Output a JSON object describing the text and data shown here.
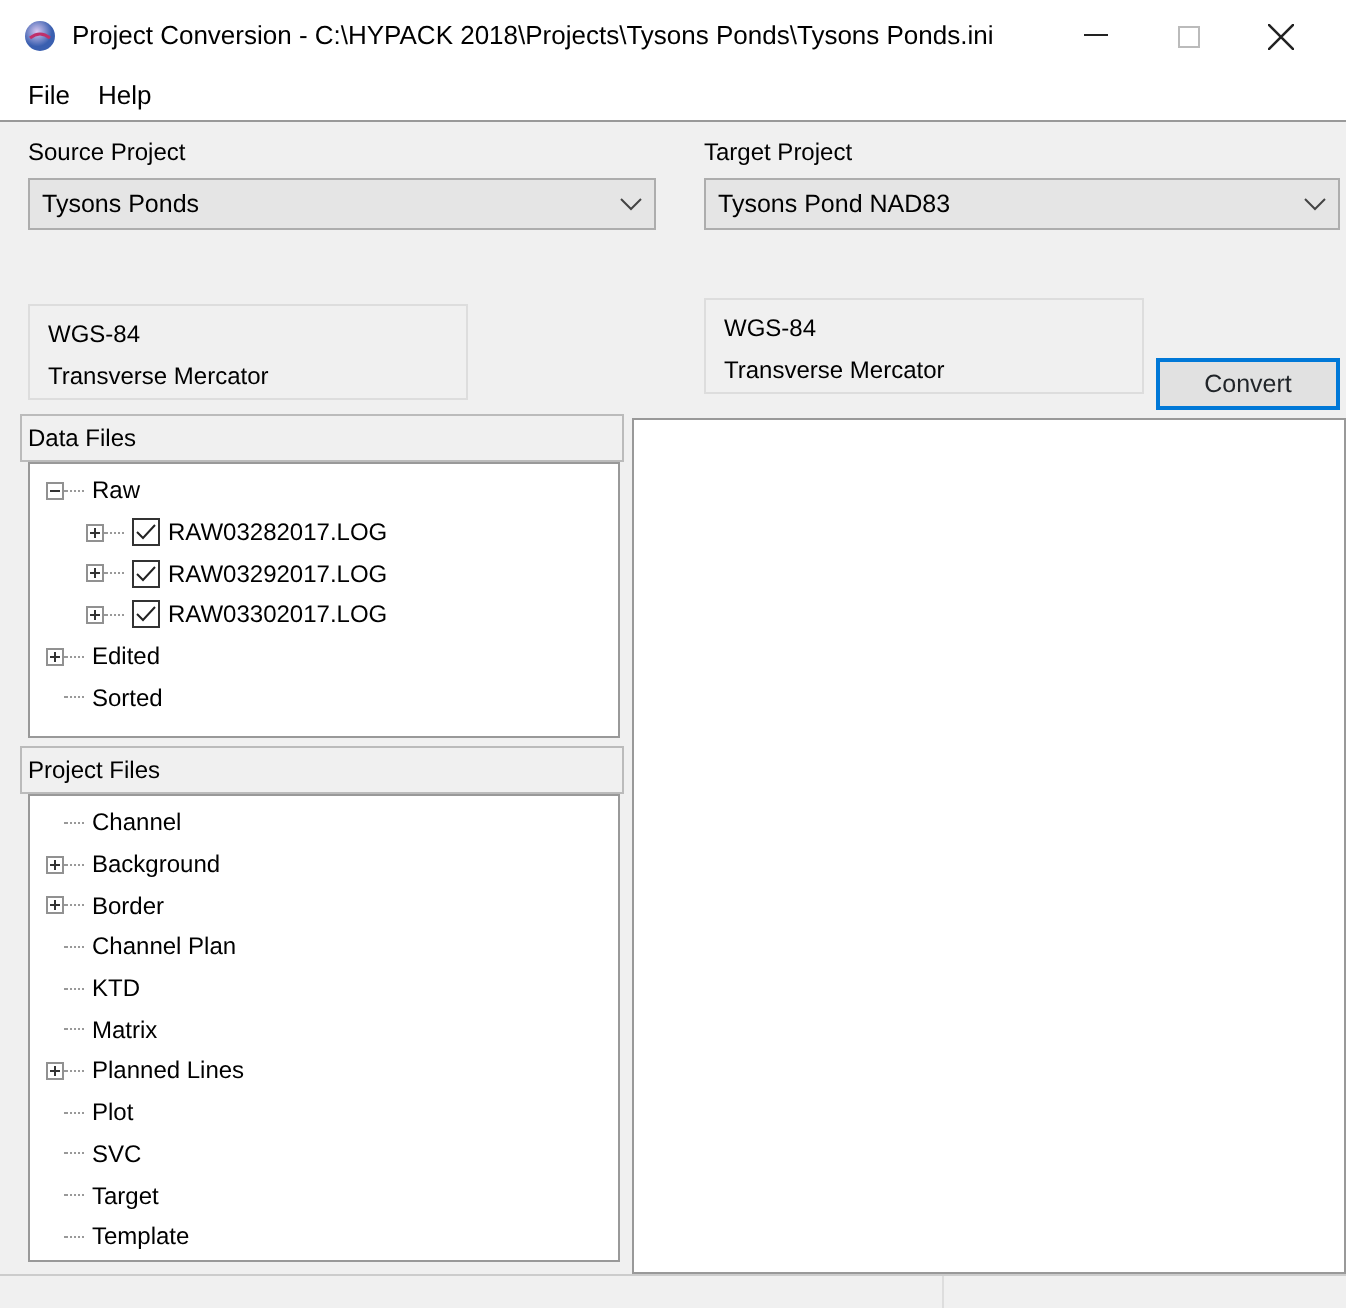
{
  "window": {
    "title": "Project Conversion - C:\\HYPACK 2018\\Projects\\Tysons Ponds\\Tysons Ponds.ini"
  },
  "menu": [
    "File",
    "Help"
  ],
  "source": {
    "label": "Source Project",
    "value": "Tysons Ponds",
    "datum": "WGS-84",
    "projection": "Transverse Mercator"
  },
  "target": {
    "label": "Target Project",
    "value": "Tysons Pond NAD83",
    "datum": "WGS-84",
    "projection": "Transverse Mercator"
  },
  "convert_button": "Convert",
  "data_files": {
    "title": "Data Files",
    "tree": [
      {
        "label": "Raw",
        "expanded": true,
        "children": [
          {
            "label": "RAW03282017.LOG",
            "expanded": false,
            "checked": true
          },
          {
            "label": "RAW03292017.LOG",
            "expanded": false,
            "checked": true
          },
          {
            "label": "RAW03302017.LOG",
            "expanded": false,
            "checked": true
          }
        ]
      },
      {
        "label": "Edited",
        "expanded": false
      },
      {
        "label": "Sorted"
      }
    ]
  },
  "project_files": {
    "title": "Project Files",
    "tree": [
      {
        "label": "Channel"
      },
      {
        "label": "Background",
        "expanded": false
      },
      {
        "label": "Border",
        "expanded": false
      },
      {
        "label": "Channel Plan"
      },
      {
        "label": "KTD"
      },
      {
        "label": "Matrix"
      },
      {
        "label": "Planned Lines",
        "expanded": false
      },
      {
        "label": "Plot"
      },
      {
        "label": "SVC"
      },
      {
        "label": "Target"
      },
      {
        "label": "Template"
      }
    ]
  }
}
